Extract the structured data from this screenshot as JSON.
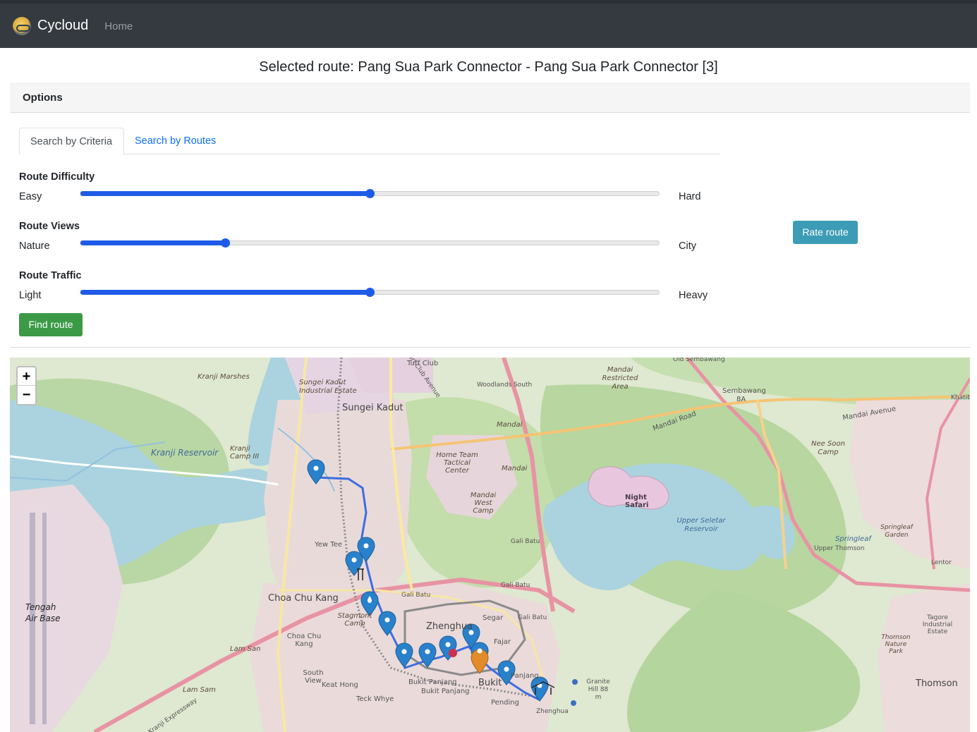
{
  "navbar": {
    "brand": "Cycloud",
    "home": "Home"
  },
  "page": {
    "title": "Selected route: Pang Sua Park Connector - Pang Sua Park Connector [3]"
  },
  "options": {
    "header": "Options"
  },
  "tabs": [
    {
      "label": "Search by Criteria",
      "active": true
    },
    {
      "label": "Search by Routes",
      "active": false
    }
  ],
  "criteria": [
    {
      "label": "Route Difficulty",
      "low": "Easy",
      "high": "Hard",
      "value": 0.5
    },
    {
      "label": "Route Views",
      "low": "Nature",
      "high": "City",
      "value": 0.25
    },
    {
      "label": "Route Traffic",
      "low": "Light",
      "high": "Heavy",
      "value": 0.5
    }
  ],
  "buttons": {
    "rate": "Rate route",
    "find": "Find route"
  },
  "map": {
    "zoom_in": "+",
    "zoom_out": "−",
    "labels": {
      "turf_club": "Turf Club",
      "turf_club_ave": "Turf Club Avenue",
      "woodlands_south": "Woodlands South",
      "sungei_kadut_ind": "Sungei Kadut Industrial Estate",
      "sungei_kadut": "Sungei Kadut",
      "kranji_marshes": "Kranji Marshes",
      "kranji_reservoir": "Kranji Reservoir",
      "kranji_camp": "Kranji Camp III",
      "mandai_restricted": "Mandai Restricted Area",
      "sembawang": "Sembawang",
      "sembawang_8a": "8A",
      "mandai_road": "Mandai Road",
      "mandai_avenue": "Mandai Avenue",
      "nee_soon": "Nee Soon Camp",
      "home_team": "Home Team Tactical Center",
      "mandai_1": "Mandai",
      "mandai_2": "Mandai",
      "mandai_west": "Mandai West Camp",
      "night_safari": "Night Safari",
      "upper_seletar": "Upper Seletar Reservoir",
      "springleaf": "Springleaf",
      "springleaf_garden": "Springleaf Garden",
      "upper_thomson": "Upper Thomson",
      "lentor": "Lentor",
      "yew_tee": "Yew Tee",
      "gali_batu_1": "Gali Batu",
      "gali_batu_2": "Gali Batu",
      "gali_batu_3": "Gali Batu",
      "gali_batu_4": "Gali Batu",
      "choa_chu_kang": "Choa Chu Kang",
      "stagmont": "Stagmont Camp",
      "zhenghua": "Zhenghua",
      "segar": "Segar",
      "fajar": "Fajar",
      "tengah": "Tengah Air Base",
      "lam_san": "Lam San",
      "choa_chu_kang_2": "Choa Chu Kang",
      "south_view": "South View",
      "keat_hong": "Keat Hong",
      "bukit_panjang_1": "Bukit Panjang",
      "bukit_panjang_2": "Bukit Panjang",
      "bukit": "Bukit",
      "panjang": "Panjang",
      "pending": "Pending",
      "zhenghua_2": "Zhenghua",
      "teck_whye": "Teck Whye",
      "lam_sam": "Lam Sam",
      "granite_hill": "Granite Hill 88 m",
      "thomson_nature": "Thomson Nature Park",
      "tagore": "Tagore Industrial Estate",
      "thomson": "Thomson",
      "khatib": "Khatib",
      "kranji_expressway": "Kranji Expressway",
      "old_sembawang": "Old Sembawang"
    }
  }
}
